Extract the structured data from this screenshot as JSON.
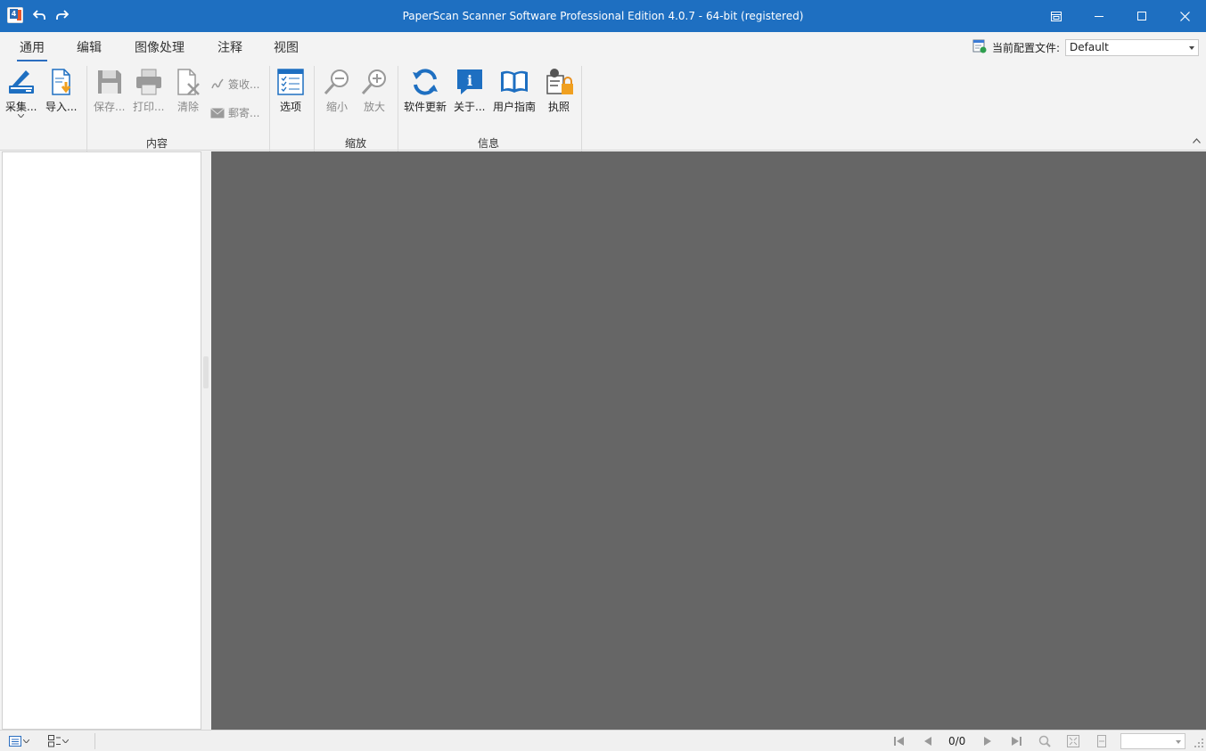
{
  "window": {
    "title": "PaperScan Scanner Software Professional Edition 4.0.7 - 64-bit (registered)",
    "app_icon_label": "4"
  },
  "tabs": [
    {
      "label": "通用",
      "active": true
    },
    {
      "label": "编辑",
      "active": false
    },
    {
      "label": "图像处理",
      "active": false
    },
    {
      "label": "注释",
      "active": false
    },
    {
      "label": "视图",
      "active": false
    }
  ],
  "profile": {
    "label": "当前配置文件:",
    "value": "Default"
  },
  "ribbon": {
    "acquire": "采集...",
    "import": "导入...",
    "save": "保存...",
    "print": "打印...",
    "clear": "清除",
    "sign": "簽收...",
    "mail": "郵寄...",
    "options": "选项",
    "zoom_out": "缩小",
    "zoom_in": "放大",
    "update": "软件更新",
    "about": "关于...",
    "guide": "用户指南",
    "license": "执照",
    "groups": {
      "content": "内容",
      "zoom": "缩放",
      "info": "信息"
    }
  },
  "statusbar": {
    "page_indicator": "0/0"
  },
  "colors": {
    "titlebar": "#1e6fc1",
    "accent": "#2b6ec0",
    "viewer_bg": "#666666"
  }
}
